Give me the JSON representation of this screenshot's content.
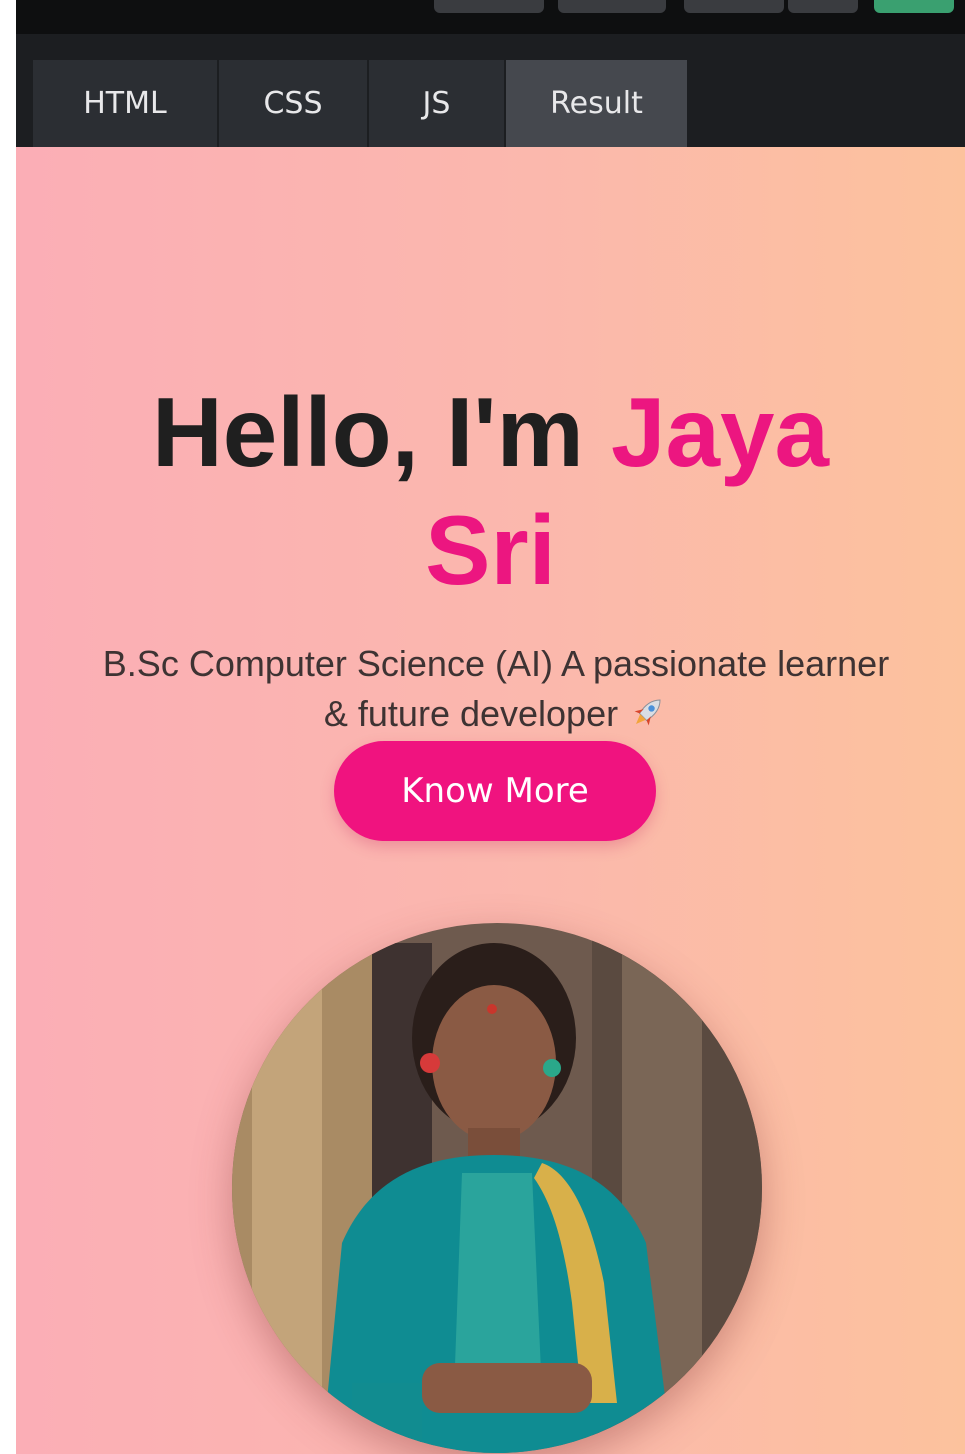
{
  "editor": {
    "tabs": [
      {
        "label": "HTML",
        "active": false
      },
      {
        "label": "CSS",
        "active": false
      },
      {
        "label": "JS",
        "active": false
      },
      {
        "label": "Result",
        "active": true
      }
    ]
  },
  "hero": {
    "greeting": "Hello, I'm",
    "name_line1": "Jaya",
    "name_line2": "Sri",
    "subtitle": "B.Sc Computer Science (AI) A passionate learner & future developer",
    "subtitle_icon": "rocket-icon",
    "cta_label": "Know More"
  },
  "colors": {
    "accent": "#ec1680",
    "button": "#f0137f",
    "gradient_start": "#fbaeb6",
    "gradient_end": "#fcc29d",
    "tabbar": "#1c1e21",
    "tab_active": "#45484e"
  },
  "profile": {
    "image": "profile-photo"
  }
}
